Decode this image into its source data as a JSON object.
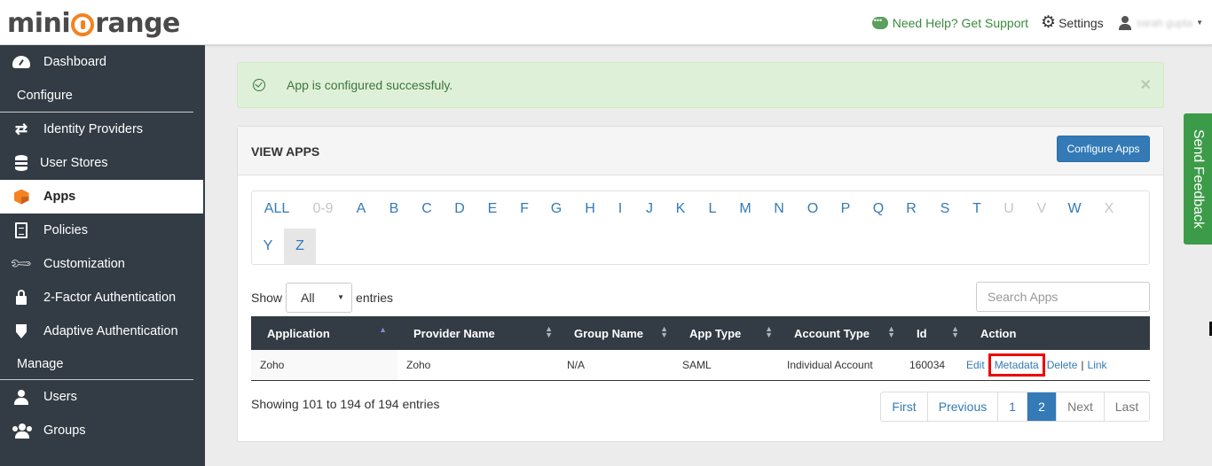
{
  "header": {
    "logo_left": "mini",
    "logo_right": "range",
    "help": "Need Help? Get Support",
    "settings": "Settings",
    "user_name": "sarah gupta"
  },
  "sidebar": {
    "dashboard": "Dashboard",
    "configure": "Configure",
    "identity_providers": "Identity Providers",
    "user_stores": "User Stores",
    "apps": "Apps",
    "policies": "Policies",
    "customization": "Customization",
    "two_factor": "2-Factor Authentication",
    "adaptive": "Adaptive Authentication",
    "manage": "Manage",
    "users": "Users",
    "groups": "Groups"
  },
  "alert": {
    "message": "App is configured successfuly.",
    "close": "×"
  },
  "panel": {
    "title": "VIEW APPS",
    "configure_button": "Configure Apps"
  },
  "alphabet": {
    "all": "ALL",
    "n09": "0-9",
    "A": "A",
    "B": "B",
    "C": "C",
    "D": "D",
    "E": "E",
    "F": "F",
    "G": "G",
    "H": "H",
    "I": "I",
    "J": "J",
    "K": "K",
    "L": "L",
    "M": "M",
    "N": "N",
    "O": "O",
    "P": "P",
    "Q": "Q",
    "R": "R",
    "S": "S",
    "T": "T",
    "U": "U",
    "V": "V",
    "W": "W",
    "X": "X",
    "Y": "Y",
    "Z": "Z"
  },
  "controls": {
    "show": "Show",
    "entries_value": "All",
    "entries": "entries",
    "search_placeholder": "Search Apps"
  },
  "table": {
    "headers": {
      "application": "Application",
      "provider": "Provider Name",
      "group": "Group Name",
      "app_type": "App Type",
      "account_type": "Account Type",
      "id": "Id",
      "action": "Action"
    },
    "row": {
      "application": "Zoho",
      "provider": "Zoho",
      "group": "N/A",
      "app_type": "SAML",
      "account_type": "Individual Account",
      "id": "160034",
      "edit": "Edit",
      "metadata": "Metadata",
      "delete": "Delete",
      "sep": "|",
      "link": "Link"
    }
  },
  "footer": {
    "showing": "Showing 101 to 194 of 194 entries",
    "first": "First",
    "previous": "Previous",
    "p1": "1",
    "p2": "2",
    "next": "Next",
    "last": "Last"
  },
  "feedback": "Send Feedback",
  "colors": {
    "sidebar_bg": "#333b44",
    "brand_orange": "#f58220",
    "primary_blue": "#337ab7",
    "success_bg": "#dff0d8",
    "feedback_green": "#3c9b48",
    "highlight_red": "#ee0000"
  }
}
